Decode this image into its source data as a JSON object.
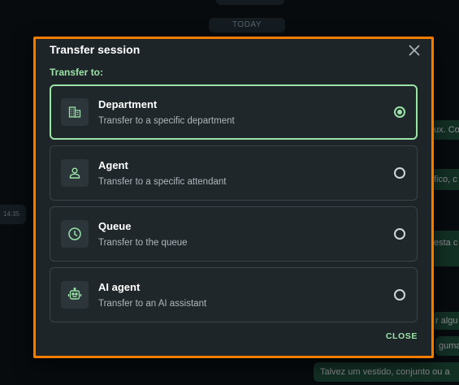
{
  "background": {
    "date_label": "TODAY",
    "time_label": "14:35",
    "bubbles": [
      "ux. Co",
      "fico, c",
      "esta c",
      "r algu",
      "guma",
      "Talvez um vestido, conjunto ou a"
    ]
  },
  "modal": {
    "title": "Transfer session",
    "transfer_to_label": "Transfer to:",
    "options": [
      {
        "title": "Department",
        "description": "Transfer to a specific department",
        "icon": "building-icon",
        "selected": true
      },
      {
        "title": "Agent",
        "description": "Transfer to a specific attendant",
        "icon": "person-icon",
        "selected": false
      },
      {
        "title": "Queue",
        "description": "Transfer to the queue",
        "icon": "clock-icon",
        "selected": false
      },
      {
        "title": "AI agent",
        "description": "Transfer to an AI assistant",
        "icon": "robot-icon",
        "selected": false
      }
    ],
    "close_label": "CLOSE"
  },
  "colors": {
    "accent": "#9be3a7",
    "highlight_border": "#f57c00",
    "modal_bg": "#1e2529"
  }
}
